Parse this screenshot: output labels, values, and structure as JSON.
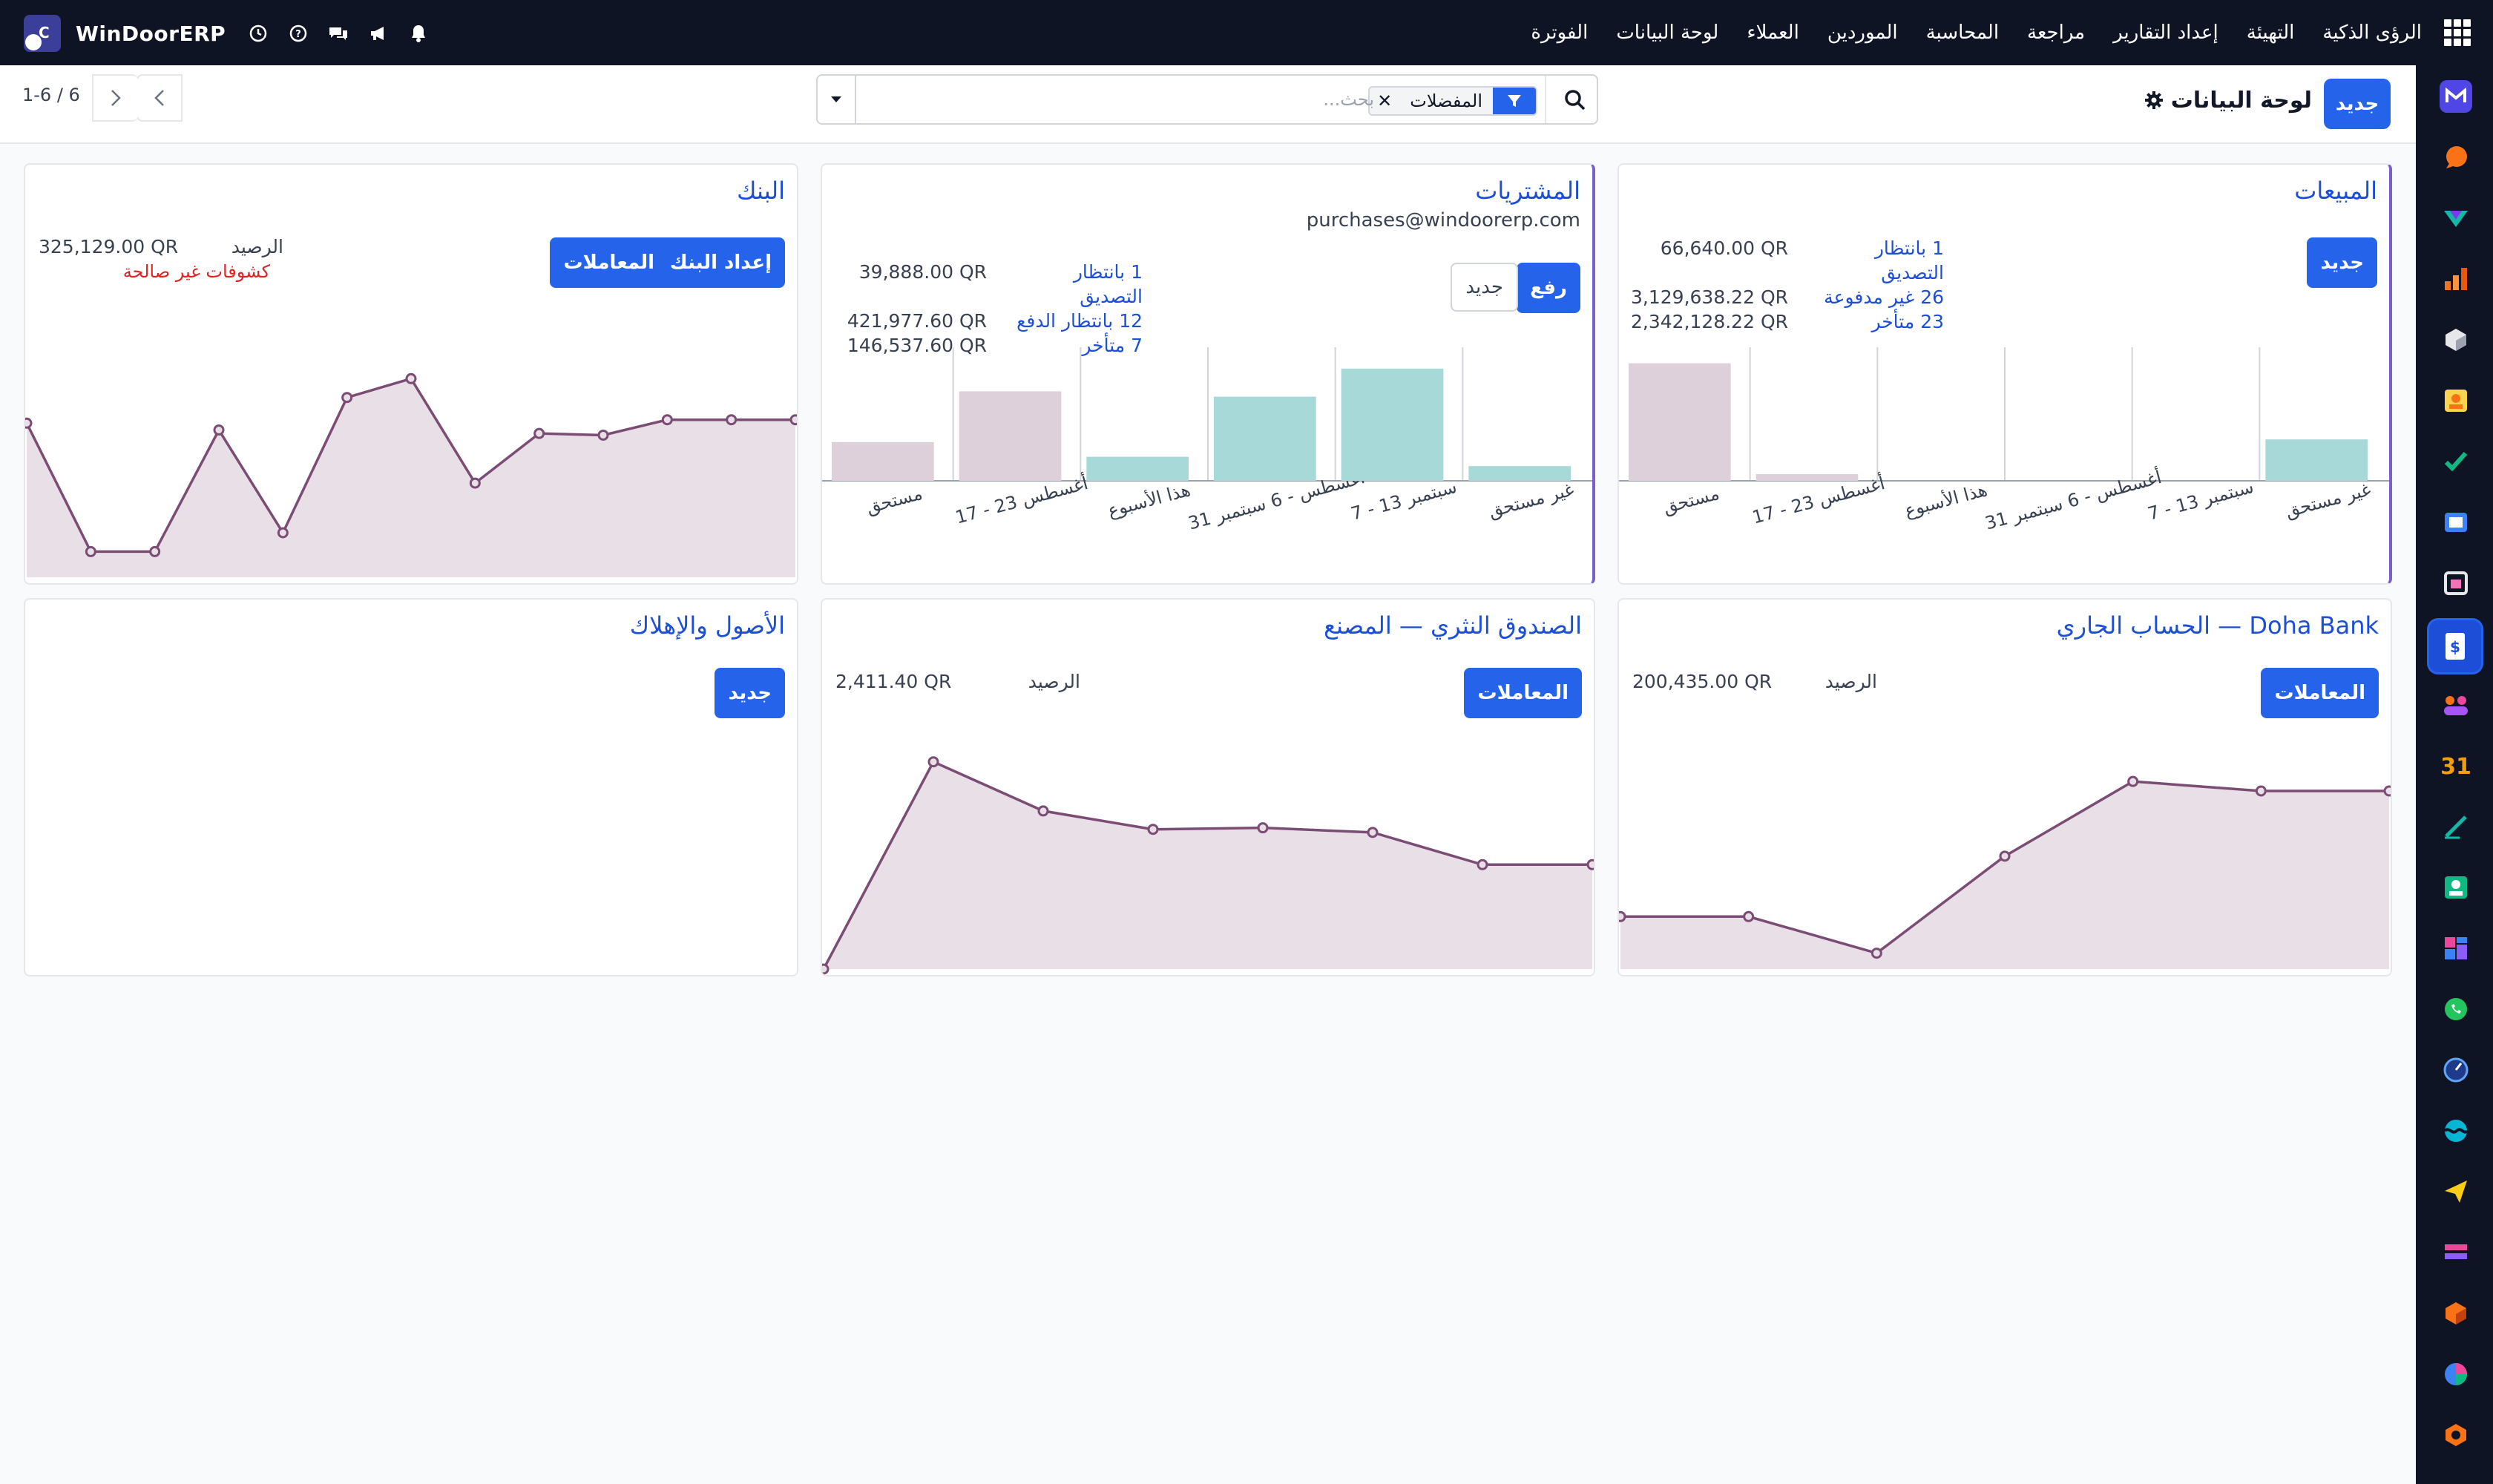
{
  "topbar": {
    "brand": "WinDoorERP",
    "menu": [
      "الفوترة",
      "لوحة البيانات",
      "العملاء",
      "الموردين",
      "المحاسبة",
      "مراجعة",
      "إعداد التقارير",
      "التهيئة",
      "الرؤى الذكية"
    ]
  },
  "control": {
    "new_label": "جديد",
    "title": "لوحة البيانات",
    "facet_label": "المفضلات",
    "search_placeholder": "بحث...",
    "pager_text": "1-6 / 6"
  },
  "cards": {
    "sales": {
      "title": "المبيعات",
      "new_label": "جديد",
      "stats": [
        {
          "label": "1 بانتظار التصديق",
          "amount": "66,640.00 QR"
        },
        {
          "label": "26 غير مدفوعة",
          "amount": "3,129,638.22 QR"
        },
        {
          "label": "23 متأخر",
          "amount": "2,342,128.22 QR"
        }
      ]
    },
    "purchases": {
      "title": "المشتريات",
      "email": "purchases@windoorerp.com",
      "upload_label": "رفع",
      "new_label": "جديد",
      "stats": [
        {
          "label": "1 بانتظار التصديق",
          "amount": "39,888.00 QR"
        },
        {
          "label": "12 بانتظار الدفع",
          "amount": "421,977.60 QR"
        },
        {
          "label": "7 متأخر",
          "amount": "146,537.60 QR"
        }
      ]
    },
    "bank": {
      "title": "البنك",
      "setup_label": "إعداد البنك",
      "transactions_label": "المعاملات",
      "balance_label": "الرصيد",
      "balance": "325,129.00 QR",
      "invalid_statements": "كشوفات غير صالحة"
    },
    "doha": {
      "title": "Doha Bank — الحساب الجاري",
      "transactions_label": "المعاملات",
      "balance_label": "الرصيد",
      "balance": "200,435.00 QR"
    },
    "petty": {
      "title": "الصندوق النثري — المصنع",
      "transactions_label": "المعاملات",
      "balance_label": "الرصيد",
      "balance": "2,411.40 QR"
    },
    "assets": {
      "title": "الأصول والإهلاك",
      "new_label": "جديد"
    }
  },
  "chart_data": [
    {
      "type": "bar",
      "card": "sales",
      "categories": [
        "مستحق",
        "17 - 23 أغسطس",
        "هذا الأسبوع",
        "31 أغسطس - 6 سبتمبر",
        "7 - 13 سبتمبر",
        "غير مستحق"
      ],
      "values": [
        88,
        5,
        0,
        0,
        0,
        31
      ],
      "colors": [
        "#ddd0da",
        "#ddd0da",
        "#a6d9d8",
        "#a6d9d8",
        "#a6d9d8",
        "#a6d9d8"
      ],
      "ylim": [
        0,
        100
      ]
    },
    {
      "type": "bar",
      "card": "purchases",
      "categories": [
        "مستحق",
        "17 - 23 أغسطس",
        "هذا الأسبوع",
        "31 أغسطس - 6 سبتمبر",
        "7 - 13 سبتمبر",
        "غير مستحق"
      ],
      "values": [
        29,
        67,
        18,
        63,
        84,
        11
      ],
      "colors": [
        "#ddd0da",
        "#ddd0da",
        "#a6d9d8",
        "#a6d9d8",
        "#a6d9d8",
        "#a6d9d8"
      ],
      "ylim": [
        0,
        100
      ]
    },
    {
      "type": "area",
      "card": "bank",
      "values": [
        90,
        15,
        15,
        86,
        26,
        105,
        116,
        55,
        84,
        83,
        92,
        92,
        92
      ],
      "ylim": [
        0,
        130
      ]
    },
    {
      "type": "area",
      "card": "doha",
      "values": [
        33,
        33,
        10,
        71,
        118,
        112,
        112
      ],
      "ylim": [
        0,
        140
      ]
    },
    {
      "type": "area",
      "card": "petty",
      "values": [
        0,
        135,
        103,
        91,
        92,
        89,
        68,
        68
      ],
      "ylim": [
        0,
        145
      ]
    }
  ]
}
